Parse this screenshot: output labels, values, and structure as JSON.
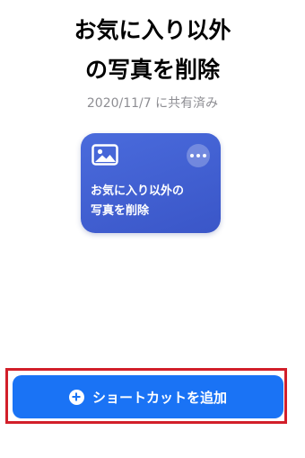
{
  "shortcut": {
    "title_line1": "お気に入り以外",
    "title_line2": "の写真を削除",
    "shared_date": "2020/11/7 に共有済み",
    "card_title_line1": "お気に入り以外の",
    "card_title_line2": "写真を削除",
    "card_color": "#3f5fd0",
    "card_icon": "photo-icon"
  },
  "actions": {
    "add_label": "ショートカットを追加",
    "add_color": "#1a73f5",
    "highlight_color": "#d21f2a"
  }
}
